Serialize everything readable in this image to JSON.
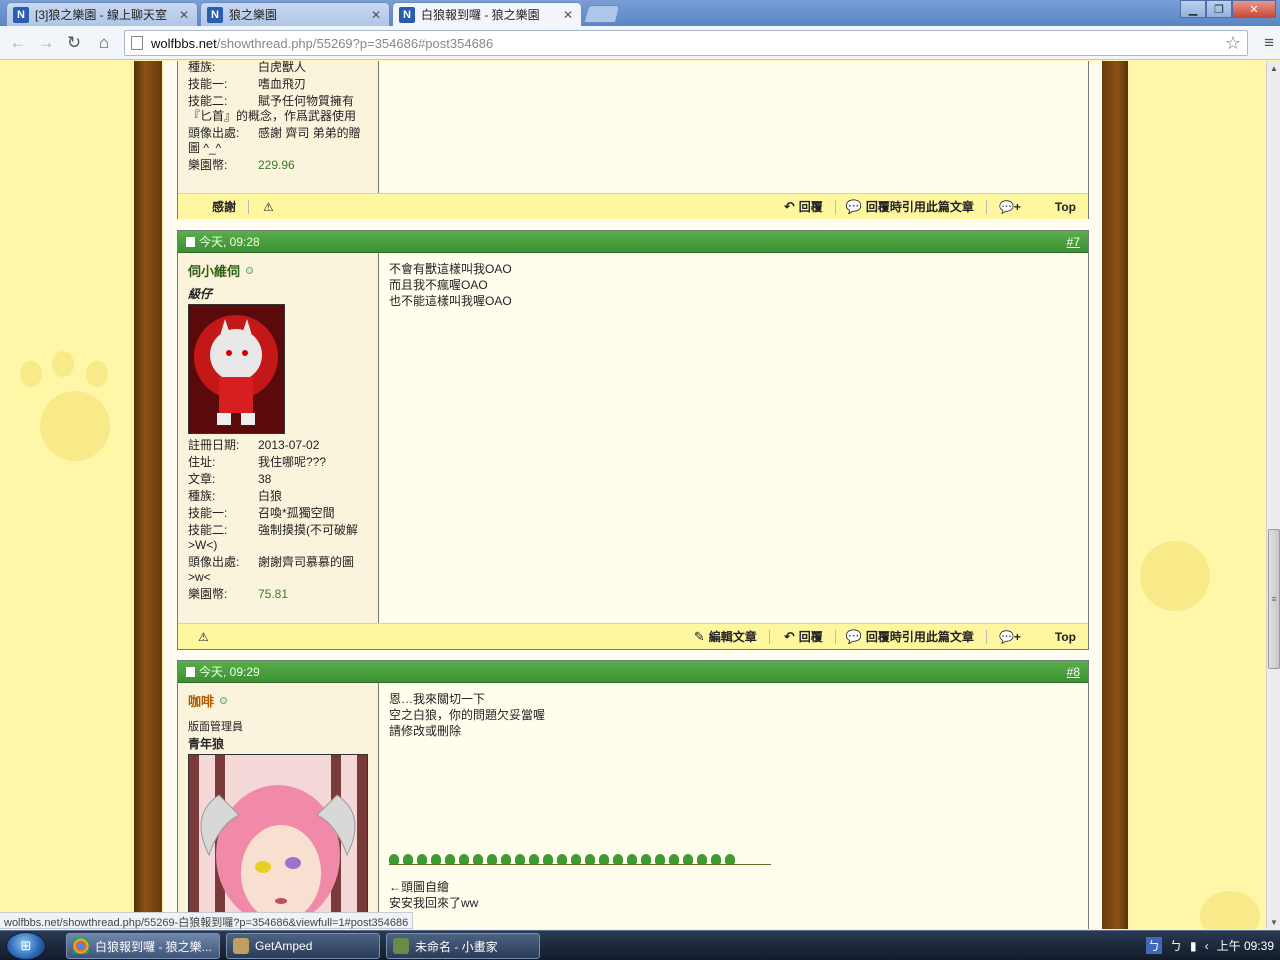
{
  "browser": {
    "tabs": [
      {
        "label": "[3]狼之樂園 - 線上聊天室",
        "favicon": "N"
      },
      {
        "label": "狼之樂園",
        "favicon": "N"
      },
      {
        "label": "白狼報到囉 - 狼之樂園",
        "favicon": "N"
      }
    ],
    "url_host": "wolfbbs.net",
    "url_path": "/showthread.php/55269?p=354686#post354686"
  },
  "prev_post": {
    "info": [
      {
        "k": "種族:",
        "v": "白虎獸人"
      },
      {
        "k": "技能一:",
        "v": "嗜血飛刃"
      },
      {
        "k": "技能二:",
        "v": "賦予任何物質擁有『匕首』的概念，作爲武器使用"
      },
      {
        "k": "頭像出處:",
        "v": "感謝 齊司 弟弟的贈圖 ^_^"
      },
      {
        "k": "樂園幣:",
        "v": "229.96"
      }
    ],
    "footer": {
      "thanks": "感謝",
      "reply": "回覆",
      "quote": "回覆時引用此篇文章",
      "top": "Top"
    }
  },
  "post7": {
    "date": "今天, 09:28",
    "number": "#7",
    "username": "伺小維伺",
    "rank": "級仔",
    "info": [
      {
        "k": "註冊日期:",
        "v": "2013-07-02"
      },
      {
        "k": "住址:",
        "v": "我住哪呢???"
      },
      {
        "k": "文章:",
        "v": "38"
      },
      {
        "k": "種族:",
        "v": "白狼"
      },
      {
        "k": "技能一:",
        "v": "召喚*孤獨空間"
      },
      {
        "k": "技能二:",
        "v": "強制摸摸(不可破解>W<)"
      },
      {
        "k": "頭像出處:",
        "v": "謝謝齊司慕慕的圖>w<"
      },
      {
        "k": "樂園幣:",
        "v": "75.81"
      }
    ],
    "lines": [
      "不會有獸這樣叫我OAO",
      "而且我不瘋喔OAO",
      "也不能這樣叫我喔OAO"
    ],
    "footer": {
      "edit": "編輯文章",
      "reply": "回覆",
      "quote": "回覆時引用此篇文章",
      "top": "Top"
    }
  },
  "post8": {
    "date": "今天, 09:29",
    "number": "#8",
    "username": "咖啡",
    "title": "版面管理員",
    "rank": "青年狼",
    "lines": [
      "恩…我來關切一下",
      "空之白狼，你的問題欠妥當喔",
      "請修改或刪除"
    ],
    "signature": [
      "←頭圖自繪",
      "安安我回來了ww"
    ]
  },
  "status_url": "wolfbbs.net/showthread.php/55269-白狼報到囉?p=354686&viewfull=1#post354686",
  "taskbar": {
    "tasks": [
      "白狼報到囉 - 狼之樂...",
      "GetAmped",
      "未命名 - 小畫家"
    ],
    "clock": "上午 09:39"
  },
  "colors": {
    "header_green": "#3d8f33",
    "page_yellow": "#fff6a8",
    "trunk_brown": "#8a5216"
  }
}
